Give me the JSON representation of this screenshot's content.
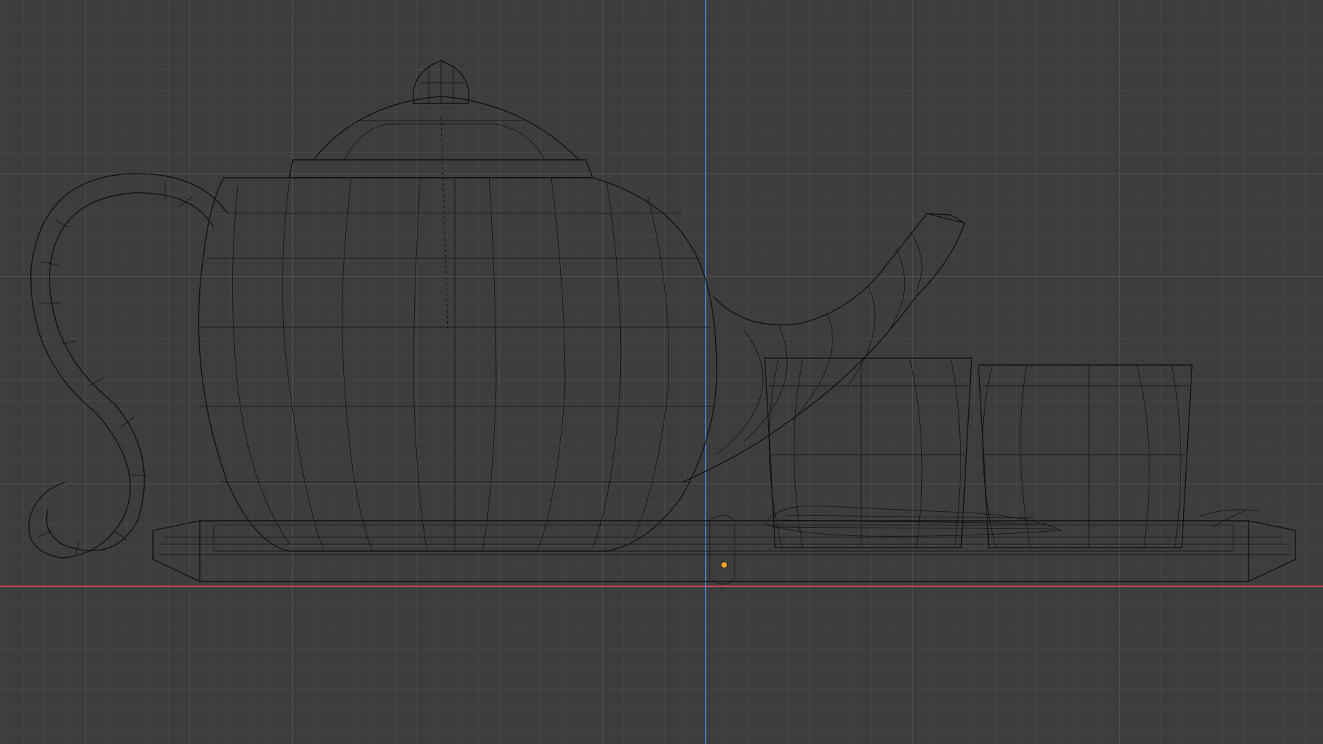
{
  "viewport": {
    "view": "front-orthographic",
    "shading": "wireframe",
    "background_color": "#3d3d3d",
    "grid_color": "#4f4f4f",
    "wire_color": "#111111"
  },
  "axes": {
    "x_color": "#c84654",
    "z_color": "#3f7fc9"
  },
  "origin": {
    "color": "#f5a623"
  },
  "scene_objects": [
    {
      "name": "teapot-body"
    },
    {
      "name": "teapot-lid"
    },
    {
      "name": "teapot-handle"
    },
    {
      "name": "teapot-spout"
    },
    {
      "name": "tea-cup-1"
    },
    {
      "name": "tea-cup-2"
    },
    {
      "name": "tray"
    },
    {
      "name": "tea-leaves"
    }
  ]
}
